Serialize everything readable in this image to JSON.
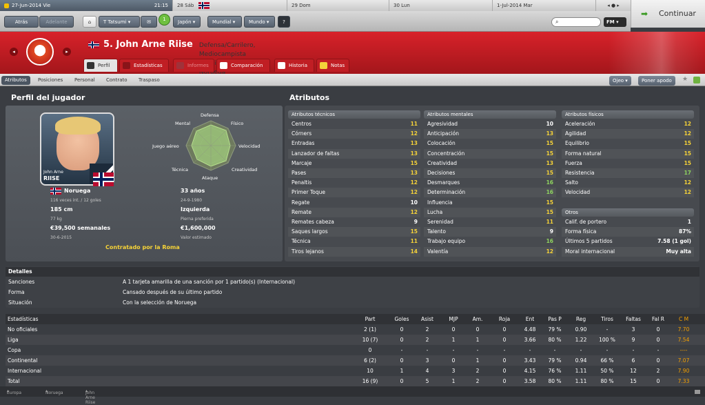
{
  "calendar": {
    "current": "27-Jun-2014 Vie",
    "time": "21:15",
    "days": [
      "28 Sáb",
      "29 Dom",
      "30 Lun",
      "1-Jul-2014 Mar"
    ]
  },
  "continue_label": "Continuar",
  "nav": {
    "back": "Atrás",
    "forward": "Adelante",
    "manager": "T Tatsumi",
    "country": "Japón",
    "world": "Mundial",
    "globe": "Mundo",
    "help": "?",
    "fm": "FM",
    "search_icon": "search-icon"
  },
  "player": {
    "title": "5. John Arne Riise",
    "subtitle": "Defensa/Carrilero, Mediocampista (Izquierda), Noruega",
    "photo_first": "John Arne",
    "photo_last": "RIISE"
  },
  "tabs": [
    "Perfil",
    "Estadísticas",
    "Informes",
    "Comparación",
    "Historia",
    "Notas"
  ],
  "subtabs": [
    "Atributos",
    "Posiciones",
    "Personal",
    "Contrato",
    "Traspaso"
  ],
  "sub_buttons": {
    "scout": "Ojeo",
    "nickname": "Poner apodo"
  },
  "profile": {
    "heading": "Perfil del jugador",
    "radar_labels": [
      "Defensa",
      "Físico",
      "Velocidad",
      "Creatividad",
      "Ataque",
      "Técnica",
      "Juego aéreo",
      "Mental"
    ],
    "nationality": "Noruega",
    "caps": "116 veces int. / 12 goles",
    "age": "33 años",
    "dob": "24-9-1980",
    "height": "185 cm",
    "weight": "77 kg",
    "foot": "Izquierda",
    "foot_label": "Pierna preferida",
    "wage": "€39,500 semanales",
    "contract_end": "30-6-2015",
    "value": "€1,600,000",
    "value_label": "Valor estimado",
    "status": "Contratado por la Roma"
  },
  "attributes": {
    "heading": "Atributos",
    "technical": {
      "title": "Atributos técnicos",
      "rows": [
        [
          "Centros",
          "11"
        ],
        [
          "Córners",
          "12"
        ],
        [
          "Entradas",
          "13"
        ],
        [
          "Lanzador de faltas",
          "13"
        ],
        [
          "Marcaje",
          "15"
        ],
        [
          "Pases",
          "13"
        ],
        [
          "Penaltis",
          "12"
        ],
        [
          "Primer Toque",
          "12"
        ],
        [
          "Regate",
          "10"
        ],
        [
          "Remate",
          "12"
        ],
        [
          "Remates cabeza",
          "9"
        ],
        [
          "Saques largos",
          "15"
        ],
        [
          "Técnica",
          "11"
        ],
        [
          "Tiros lejanos",
          "14"
        ]
      ]
    },
    "mental": {
      "title": "Atributos mentales",
      "rows": [
        [
          "Agresividad",
          "10"
        ],
        [
          "Anticipación",
          "13"
        ],
        [
          "Colocación",
          "15"
        ],
        [
          "Concentración",
          "15"
        ],
        [
          "Creatividad",
          "13"
        ],
        [
          "Decisiones",
          "15"
        ],
        [
          "Desmarques",
          "16"
        ],
        [
          "Determinación",
          "16"
        ],
        [
          "Influencia",
          "15"
        ],
        [
          "Lucha",
          "15"
        ],
        [
          "Serenidad",
          "11"
        ],
        [
          "Talento",
          "9"
        ],
        [
          "Trabajo equipo",
          "16"
        ],
        [
          "Valentía",
          "12"
        ]
      ]
    },
    "physical": {
      "title": "Atributos físicos",
      "rows": [
        [
          "Aceleración",
          "12"
        ],
        [
          "Agilidad",
          "12"
        ],
        [
          "Equilibrio",
          "15"
        ],
        [
          "Forma natural",
          "15"
        ],
        [
          "Fuerza",
          "15"
        ],
        [
          "Resistencia",
          "17"
        ],
        [
          "Salto",
          "12"
        ],
        [
          "Velocidad",
          "12"
        ]
      ]
    },
    "others": {
      "title": "Otros",
      "rows": [
        [
          "Calif. de portero",
          "1"
        ],
        [
          "Forma física",
          "87%"
        ],
        [
          "Últimos 5 partidos",
          "7.58 (1 gol)"
        ],
        [
          "Moral internacional",
          "Muy alta"
        ]
      ]
    }
  },
  "details": {
    "title": "Detalles",
    "rows": [
      [
        "Sanciones",
        "A 1 tarjeta amarilla de una sanción por 1 partido(s) (Internacional)"
      ],
      [
        "Forma",
        "Cansado después de su último partido"
      ],
      [
        "Situación",
        "Con la selección de Noruega"
      ]
    ]
  },
  "stats": {
    "header": [
      "Estadísticas",
      "Part",
      "Goles",
      "Asist",
      "MJP",
      "Am.",
      "Roja",
      "Ent",
      "Pas P",
      "Reg",
      "Tiros",
      "Faltas",
      "Fal R",
      "C M"
    ],
    "rows": [
      [
        "No oficiales",
        "2 (1)",
        "0",
        "2",
        "0",
        "0",
        "0",
        "4.48",
        "79 %",
        "0.90",
        "-",
        "3",
        "0",
        "7.70"
      ],
      [
        "Liga",
        "10 (7)",
        "0",
        "2",
        "1",
        "1",
        "0",
        "3.66",
        "80 %",
        "1.22",
        "100 %",
        "9",
        "0",
        "7.54"
      ],
      [
        "Copa",
        "0",
        "-",
        "-",
        "-",
        "-",
        "-",
        "-",
        "-",
        "-",
        "-",
        "-",
        "-",
        "----"
      ],
      [
        "Continental",
        "6 (2)",
        "0",
        "3",
        "0",
        "1",
        "0",
        "3.43",
        "79 %",
        "0.94",
        "66 %",
        "6",
        "0",
        "7.07"
      ],
      [
        "Internacional",
        "10",
        "1",
        "4",
        "3",
        "2",
        "0",
        "4.15",
        "76 %",
        "1.11",
        "50 %",
        "12",
        "2",
        "7.90"
      ],
      [
        "Total",
        "16 (9)",
        "0",
        "5",
        "1",
        "2",
        "0",
        "3.58",
        "80 %",
        "1.11",
        "80 %",
        "15",
        "0",
        "7.33"
      ]
    ]
  },
  "footer": [
    "Europa",
    "Noruega",
    "John Arne Riise"
  ]
}
